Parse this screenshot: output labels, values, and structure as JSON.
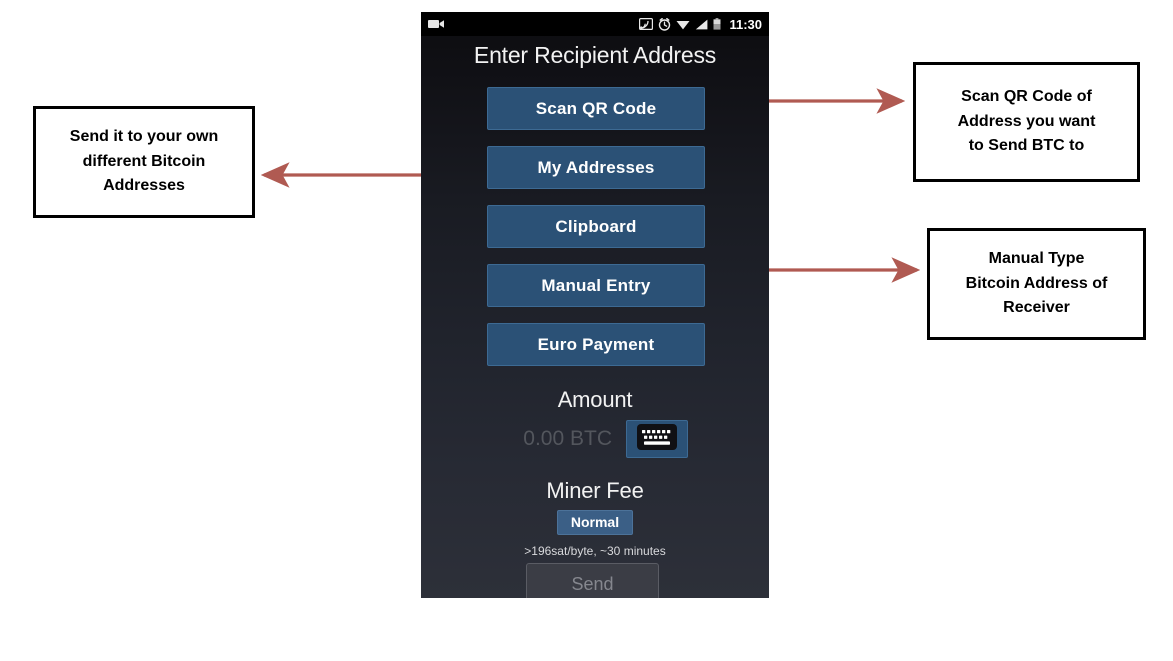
{
  "phone": {
    "status_bar": {
      "left_icons": [
        "video-camera-icon"
      ],
      "right_icons": [
        "cast-icon",
        "alarm-clock-icon",
        "wifi-icon",
        "signal-icon",
        "battery-icon"
      ],
      "time": "11:30"
    },
    "title": "Enter Recipient Address",
    "buttons": [
      {
        "label": "Scan QR Code"
      },
      {
        "label": "My Addresses"
      },
      {
        "label": "Clipboard"
      },
      {
        "label": "Manual Entry"
      },
      {
        "label": "Euro Payment"
      }
    ],
    "amount": {
      "heading": "Amount",
      "value": "0.00 BTC",
      "keyboard_icon": "keyboard-icon"
    },
    "miner_fee": {
      "heading": "Miner Fee",
      "badge": "Normal",
      "detail": ">196sat/byte, ~30 minutes"
    },
    "send_button": {
      "label": "Send",
      "state": "disabled"
    },
    "colors": {
      "button_fill": "#2b5176",
      "button_border": "#3d6a93",
      "badge_fill": "#3b5f86",
      "screen_top": "#0c0c0f",
      "screen_bottom": "#2d3039",
      "send_disabled_fill": "#3b3d45",
      "send_disabled_text": "#85878e",
      "placeholder_text": "#53565d"
    }
  },
  "annotations": {
    "arrow_color": "#b05a52",
    "callouts": [
      {
        "id": "left",
        "lines": [
          "Send it to your own",
          "different Bitcoin",
          "Addresses"
        ],
        "points_to": "My Addresses"
      },
      {
        "id": "top-right",
        "lines": [
          "Scan QR Code of",
          "Address you want",
          "to Send BTC to"
        ],
        "points_to": "Scan QR Code"
      },
      {
        "id": "bottom-right",
        "lines": [
          "Manual Type",
          "Bitcoin Address of",
          "Receiver"
        ],
        "points_to": "Manual Entry"
      }
    ]
  }
}
